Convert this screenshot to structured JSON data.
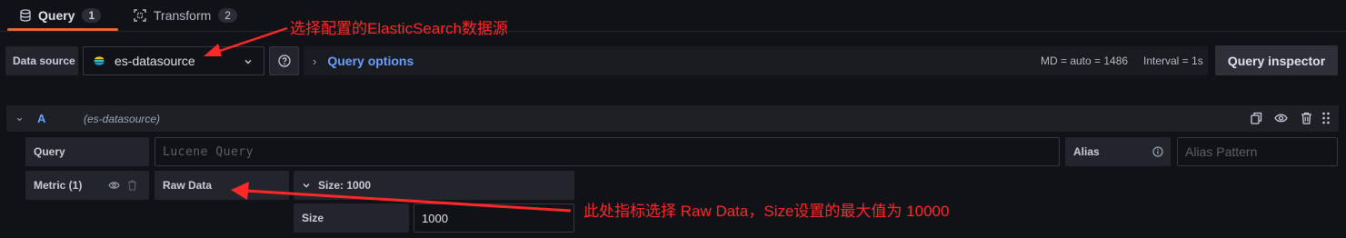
{
  "tabs": [
    {
      "label": "Query",
      "count": "1"
    },
    {
      "label": "Transform",
      "count": "2"
    }
  ],
  "toolbar": {
    "datasource_label": "Data source",
    "datasource_value": "es-datasource",
    "query_options_label": "Query options",
    "md_text": "MD = auto = 1486",
    "interval_text": "Interval = 1s",
    "inspector_label": "Query inspector"
  },
  "query_row": {
    "letter": "A",
    "datasource": "(es-datasource)",
    "query_label": "Query",
    "query_placeholder": "Lucene Query",
    "alias_label": "Alias",
    "alias_placeholder": "Alias Pattern",
    "metric_label": "Metric (1)",
    "metric_type": "Raw Data",
    "size_header": "Size: 1000",
    "size_label": "Size",
    "size_value": "1000"
  },
  "annotations": {
    "top": "选择配置的ElasticSearch数据源",
    "bottom": "此处指标选择 Raw Data，Size设置的最大值为 10000"
  },
  "colors": {
    "background": "#111217",
    "accent_orange": "#f06a2b",
    "link_blue": "#6e9fff",
    "annotation_red": "#ff2828"
  }
}
